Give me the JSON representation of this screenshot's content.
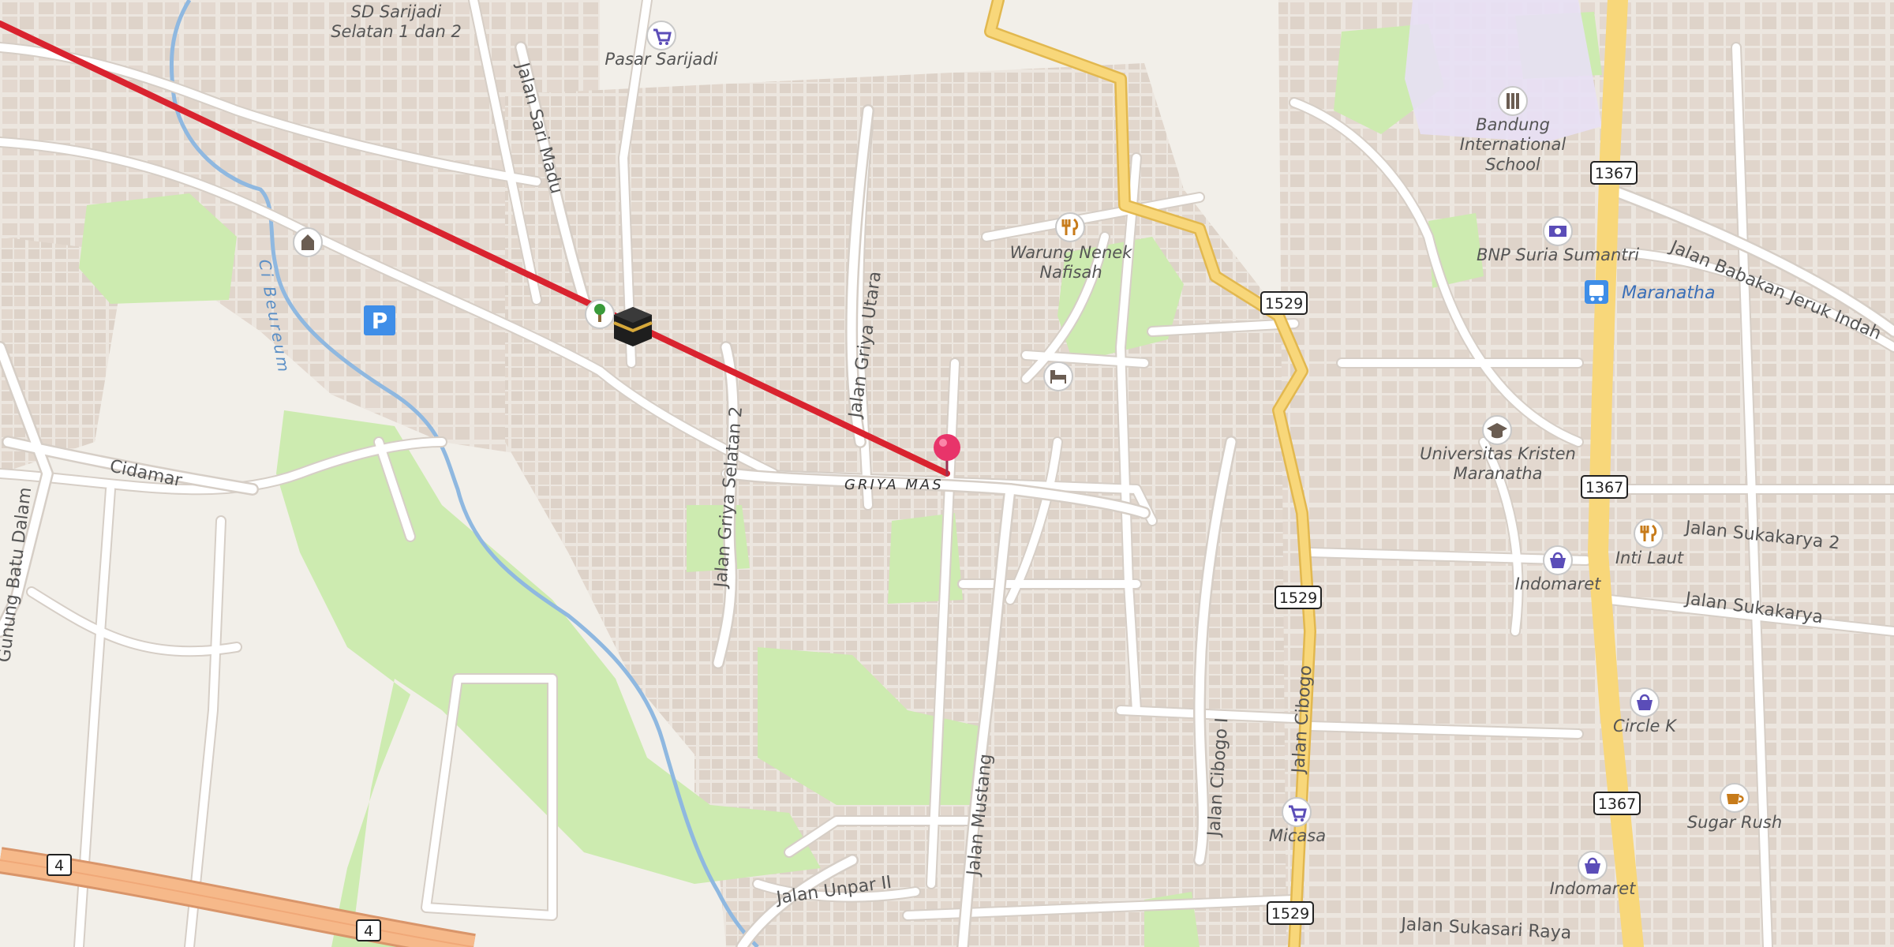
{
  "map": {
    "colors": {
      "background": "#f2efe9",
      "building": "#e3d8cf",
      "park": "#cdebb0",
      "school_area": "#e8e0f5",
      "road": "#ffffff",
      "road_casing": "#d8d0c8",
      "primary_road": "#f8d77a",
      "primary_casing": "#e2b84f",
      "highway": "#f6b98a",
      "river": "#8fb8e0",
      "route_line": "#d9232f",
      "marker": "#e8346a"
    },
    "place_labels": {
      "sd_sarijadi": "SD Sarijadi\nSelatan 1 dan 2",
      "pasar_sarijadi": "Pasar Sarijadi",
      "warung": "Warung Nenek\nNafisah",
      "bandung_school": "Bandung\nInternational\nSchool",
      "bnp": "BNP Suria Sumantri",
      "maranatha_bus": "Maranatha",
      "ukm": "Universitas Kristen\nMaranatha",
      "inti_laut": "Inti Laut",
      "indomaret_1": "Indomaret",
      "circle_k": "Circle K",
      "sugar_rush": "Sugar Rush",
      "micasa": "Micasa",
      "indomaret_2": "Indomaret"
    },
    "street_labels": {
      "sari_madu": "Jalan Sari Madu",
      "griya_utara": "Jalan Griya Utara",
      "griya_selatan_2": "Jalan Griya Selatan 2",
      "griya_mas": "GRIYA MAS",
      "cidamar": "Cidamar",
      "gunung_batu": "Gunung Batu Dalam",
      "jalan_mustang": "Jalan Mustang",
      "cibogo_1": "Jalan Cibogo I",
      "jalan_cibogo": "Jalan Cibogo",
      "unpar_2": "Jalan Unpar II",
      "sukasari_raya": "Jalan Sukasari Raya",
      "babakan_jeruk": "Jalan Babakan Jeruk Indah",
      "sukakarya_2": "Jalan Sukakarya 2",
      "sukakarya": "Jalan Sukakarya",
      "river_name": "Ci Beureum"
    },
    "route_shields": [
      "1367",
      "1367",
      "1367",
      "1529",
      "1529",
      "1529",
      "4",
      "4"
    ],
    "icons": [
      "shopping-cart-icon",
      "restaurant-icon",
      "school-icon",
      "bank-icon",
      "bus-stop-icon",
      "university-icon",
      "shopping-bag-icon",
      "cafe-icon",
      "parking-icon",
      "hotel-icon",
      "kaaba-icon",
      "place-of-worship-icon",
      "location-pin-icon"
    ]
  }
}
